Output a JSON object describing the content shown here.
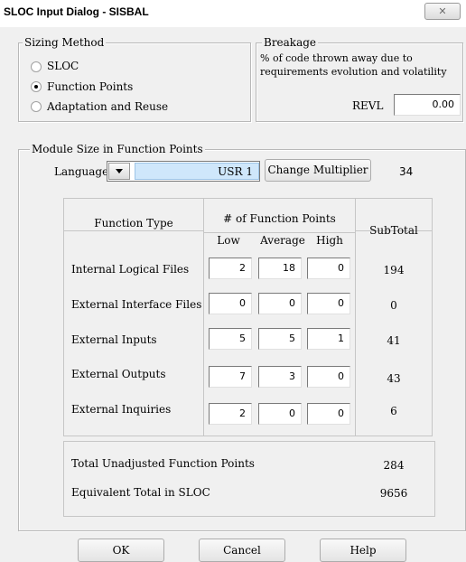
{
  "window": {
    "title": "SLOC Input Dialog - SISBAL",
    "close_glyph": "✕"
  },
  "sizing_method": {
    "legend": "Sizing Method",
    "options": [
      {
        "label": "SLOC",
        "checked": false
      },
      {
        "label": "Function Points",
        "checked": true
      },
      {
        "label": "Adaptation and Reuse",
        "checked": false
      }
    ]
  },
  "breakage": {
    "legend": "Breakage",
    "description_line1": "% of code thrown away due to",
    "description_line2": "requirements evolution and volatility",
    "revl_label": "REVL",
    "revl_value": "0.00"
  },
  "module": {
    "legend": "Module Size in Function Points",
    "language_label": "Language",
    "language_value": "USR 1",
    "change_multiplier_label": "Change Multiplier",
    "multiplier_value": "34"
  },
  "table": {
    "function_type_header": "Function Type",
    "fp_header": "# of Function Points",
    "low_header": "Low",
    "average_header": "Average",
    "high_header": "High",
    "subtotal_header": "SubTotal",
    "rows": [
      {
        "name": "Internal Logical Files",
        "low": "2",
        "average": "18",
        "high": "0",
        "subtotal": "194"
      },
      {
        "name": "External Interface Files",
        "low": "0",
        "average": "0",
        "high": "0",
        "subtotal": "0"
      },
      {
        "name": "External Inputs",
        "low": "5",
        "average": "5",
        "high": "1",
        "subtotal": "41"
      },
      {
        "name": "External Outputs",
        "low": "7",
        "average": "3",
        "high": "0",
        "subtotal": "43"
      },
      {
        "name": "External Inquiries",
        "low": "2",
        "average": "0",
        "high": "0",
        "subtotal": "6"
      }
    ]
  },
  "totals": {
    "unadjusted_label": "Total Unadjusted Function Points",
    "unadjusted_value": "284",
    "sloc_label": "Equivalent Total in SLOC",
    "sloc_value": "9656"
  },
  "buttons": {
    "ok": "OK",
    "cancel": "Cancel",
    "help": "Help"
  }
}
